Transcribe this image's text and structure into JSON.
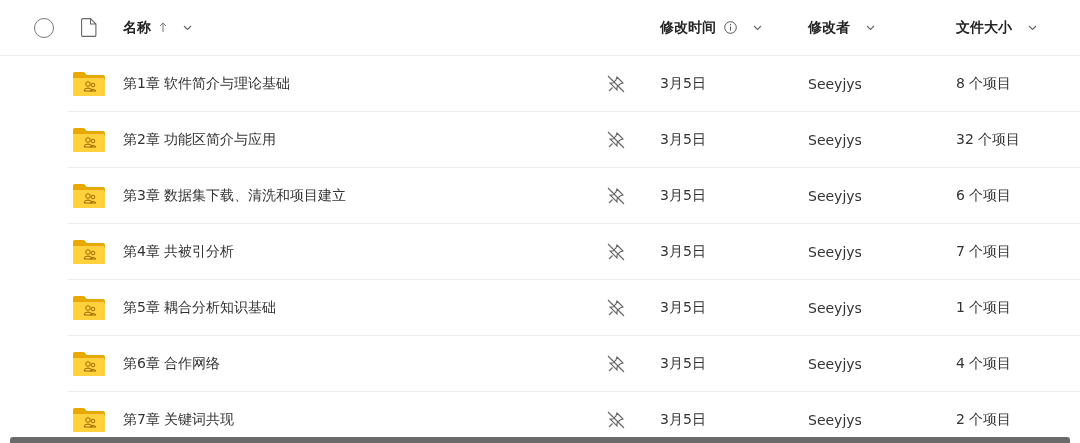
{
  "table": {
    "select_all": {
      "checked": false
    },
    "columns": [
      {
        "label": "名称",
        "sorted": true,
        "info": false
      },
      {
        "label": "修改时间",
        "sorted": false,
        "info": true
      },
      {
        "label": "修改者",
        "sorted": false,
        "info": false
      },
      {
        "label": "文件大小",
        "sorted": false,
        "info": false
      }
    ],
    "rows": [
      {
        "name": "第1章 软件简介与理论基础",
        "modified": "3月5日",
        "modified_by": "Seeyjys",
        "size": "8 个项目"
      },
      {
        "name": "第2章 功能区简介与应用",
        "modified": "3月5日",
        "modified_by": "Seeyjys",
        "size": "32 个项目"
      },
      {
        "name": "第3章 数据集下载、清洗和项目建立",
        "modified": "3月5日",
        "modified_by": "Seeyjys",
        "size": "6 个项目"
      },
      {
        "name": "第4章 共被引分析",
        "modified": "3月5日",
        "modified_by": "Seeyjys",
        "size": "7 个项目"
      },
      {
        "name": "第5章 耦合分析知识基础",
        "modified": "3月5日",
        "modified_by": "Seeyjys",
        "size": "1 个项目"
      },
      {
        "name": "第6章 合作网络",
        "modified": "3月5日",
        "modified_by": "Seeyjys",
        "size": "4 个项目"
      },
      {
        "name": "第7章 关键词共现",
        "modified": "3月5日",
        "modified_by": "Seeyjys",
        "size": "2 个项目"
      }
    ]
  }
}
